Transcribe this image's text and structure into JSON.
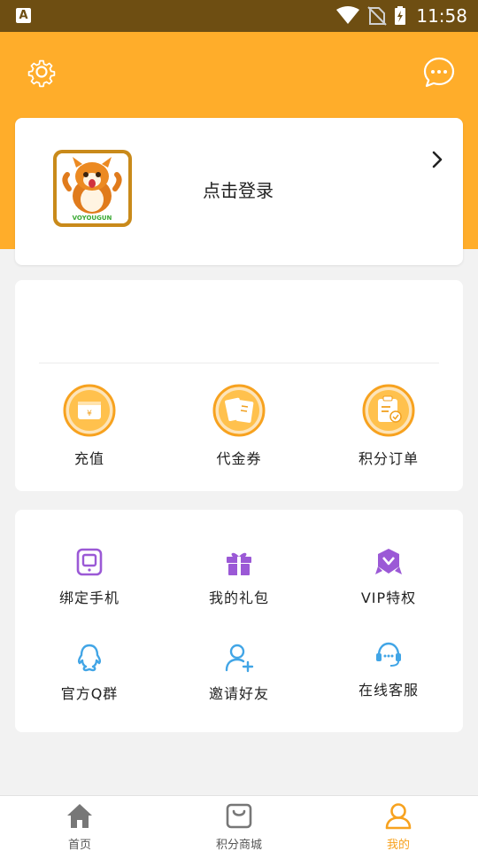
{
  "status_bar": {
    "time": "11:58",
    "notification_letter": "A"
  },
  "header": {
    "settings_icon": "gear-icon",
    "message_icon": "chat-bubble-icon"
  },
  "login": {
    "prompt": "点击登录",
    "avatar_caption": "VOYOUGUN"
  },
  "wallet": {
    "items": [
      {
        "label": "充值",
        "icon": "recharge-icon"
      },
      {
        "label": "代金券",
        "icon": "voucher-icon"
      },
      {
        "label": "积分订单",
        "icon": "points-order-icon"
      }
    ]
  },
  "services": {
    "items": [
      {
        "label": "绑定手机",
        "icon": "phone-icon"
      },
      {
        "label": "我的礼包",
        "icon": "gift-icon"
      },
      {
        "label": "VIP特权",
        "icon": "vip-badge-icon"
      },
      {
        "label": "官方Q群",
        "icon": "qq-icon"
      },
      {
        "label": "邀请好友",
        "icon": "add-user-icon"
      },
      {
        "label": "在线客服",
        "icon": "headset-icon"
      }
    ]
  },
  "tabbar": {
    "tabs": [
      {
        "label": "首页",
        "icon": "home-icon",
        "active": false
      },
      {
        "label": "积分商城",
        "icon": "shopping-bag-icon",
        "active": false
      },
      {
        "label": "我的",
        "icon": "profile-icon",
        "active": true
      }
    ]
  },
  "colors": {
    "accent": "#ffad2a",
    "active_tab": "#f7a21f",
    "purple": "#9b59d6",
    "blue": "#41a5e6"
  }
}
